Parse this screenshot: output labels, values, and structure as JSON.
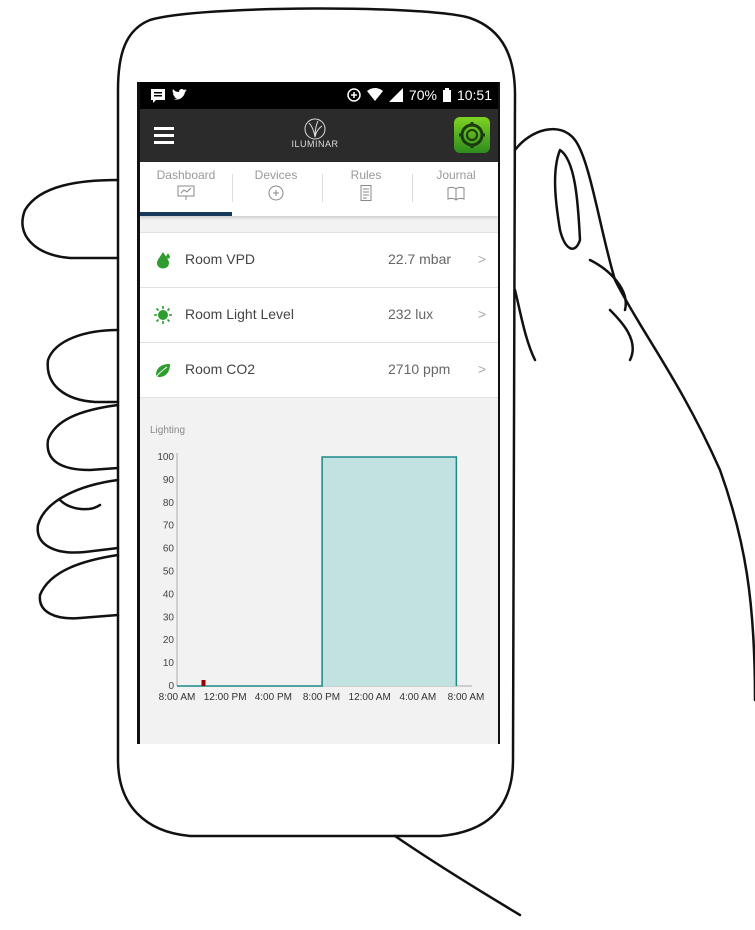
{
  "statusbar": {
    "battery": "70%",
    "time": "10:51"
  },
  "app": {
    "logo_text": "ILUMINAR"
  },
  "tabs": [
    {
      "label": "Dashboard",
      "icon": "presentation-icon",
      "active": true
    },
    {
      "label": "Devices",
      "icon": "device-icon",
      "active": false
    },
    {
      "label": "Rules",
      "icon": "document-icon",
      "active": false
    },
    {
      "label": "Journal",
      "icon": "book-icon",
      "active": false
    }
  ],
  "readings": [
    {
      "label": "Room VPD",
      "value": "22.7 mbar",
      "icon": "droplet-icon",
      "chevron": ">"
    },
    {
      "label": "Room Light Level",
      "value": "232 lux",
      "icon": "sun-icon",
      "chevron": ">"
    },
    {
      "label": "Room CO2",
      "value": "2710 ppm",
      "icon": "leaf-icon",
      "chevron": ">"
    }
  ],
  "chart_data": {
    "type": "area",
    "title": "Lighting",
    "x": [
      "8:00 AM",
      "12:00 PM",
      "4:00 PM",
      "8:00 PM",
      "12:00 AM",
      "4:00 AM",
      "8:00 AM"
    ],
    "series": [
      {
        "values_hours": [
          0,
          12.05,
          12.05,
          23.2,
          23.2
        ],
        "values": [
          0,
          0,
          100,
          100,
          0
        ]
      }
    ],
    "yticks": [
      0,
      10,
      20,
      30,
      40,
      50,
      60,
      70,
      80,
      90,
      100
    ],
    "ylim": [
      0,
      100
    ],
    "marker_hours": 2.2,
    "colors": {
      "fill": "#c2e2e1",
      "line": "#1a8a8a",
      "marker": "#990000"
    }
  }
}
